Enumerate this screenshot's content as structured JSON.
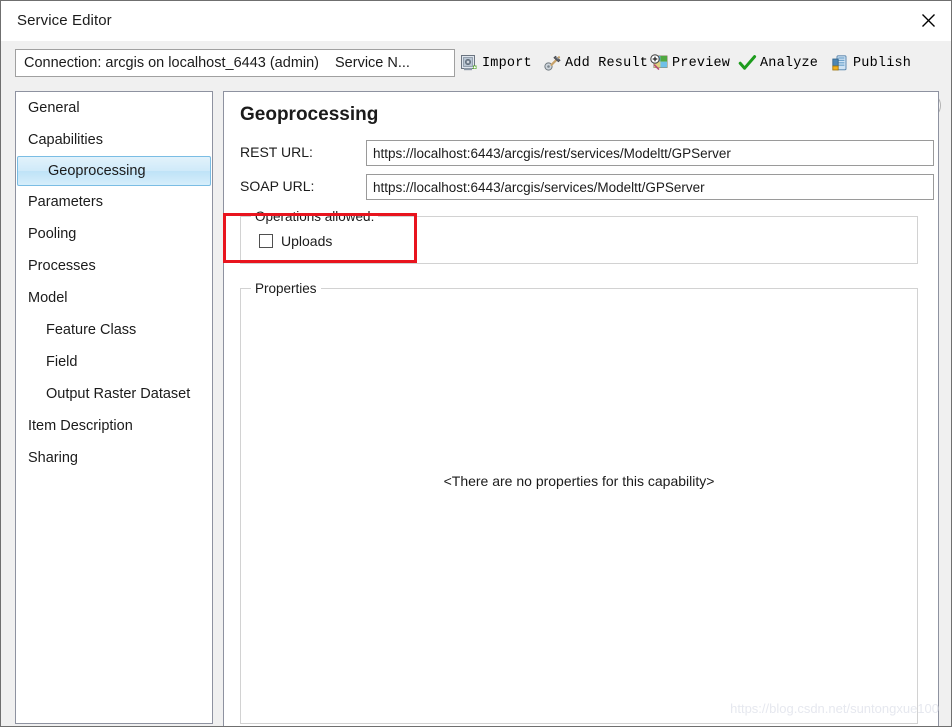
{
  "window": {
    "title": "Service Editor",
    "close_icon": "close-icon"
  },
  "toolbar": {
    "connection_text": "Connection: arcgis on localhost_6443 (admin)",
    "service_name_text": "Service N...",
    "buttons": [
      {
        "label": "Import",
        "icon": "import-icon"
      },
      {
        "label": "Add Result",
        "icon": "add-result-icon"
      },
      {
        "label": "Preview",
        "icon": "preview-icon"
      },
      {
        "label": "Analyze",
        "icon": "analyze-check-icon"
      },
      {
        "label": "Publish",
        "icon": "publish-icon"
      }
    ],
    "collapse_icon": "chevron-up-icon"
  },
  "sidebar": {
    "items": [
      {
        "label": "General",
        "indent": false,
        "selected": false
      },
      {
        "label": "Capabilities",
        "indent": false,
        "selected": false
      },
      {
        "label": "Geoprocessing",
        "indent": true,
        "selected": true
      },
      {
        "label": "Parameters",
        "indent": false,
        "selected": false
      },
      {
        "label": "Pooling",
        "indent": false,
        "selected": false
      },
      {
        "label": "Processes",
        "indent": false,
        "selected": false
      },
      {
        "label": "Model",
        "indent": false,
        "selected": false
      },
      {
        "label": "Feature Class",
        "indent": true,
        "selected": false
      },
      {
        "label": "Field",
        "indent": true,
        "selected": false
      },
      {
        "label": "Output Raster Dataset",
        "indent": true,
        "selected": false
      },
      {
        "label": "Item Description",
        "indent": false,
        "selected": false
      },
      {
        "label": "Sharing",
        "indent": false,
        "selected": false
      }
    ]
  },
  "main": {
    "heading": "Geoprocessing",
    "rest_url_label": "REST URL:",
    "rest_url_value": "https://localhost:6443/arcgis/rest/services/Modeltt/GPServer",
    "soap_url_label": "SOAP URL:",
    "soap_url_value": "https://localhost:6443/arcgis/services/Modeltt/GPServer",
    "operations_legend": "Operations allowed:",
    "uploads_label": "Uploads",
    "uploads_checked": false,
    "properties_legend": "Properties",
    "properties_empty_text": "<There are no properties for this capability>"
  },
  "annotation": {
    "color": "#e8141e"
  },
  "watermark": {
    "text": "https://blog.csdn.net/suntongxue100"
  }
}
